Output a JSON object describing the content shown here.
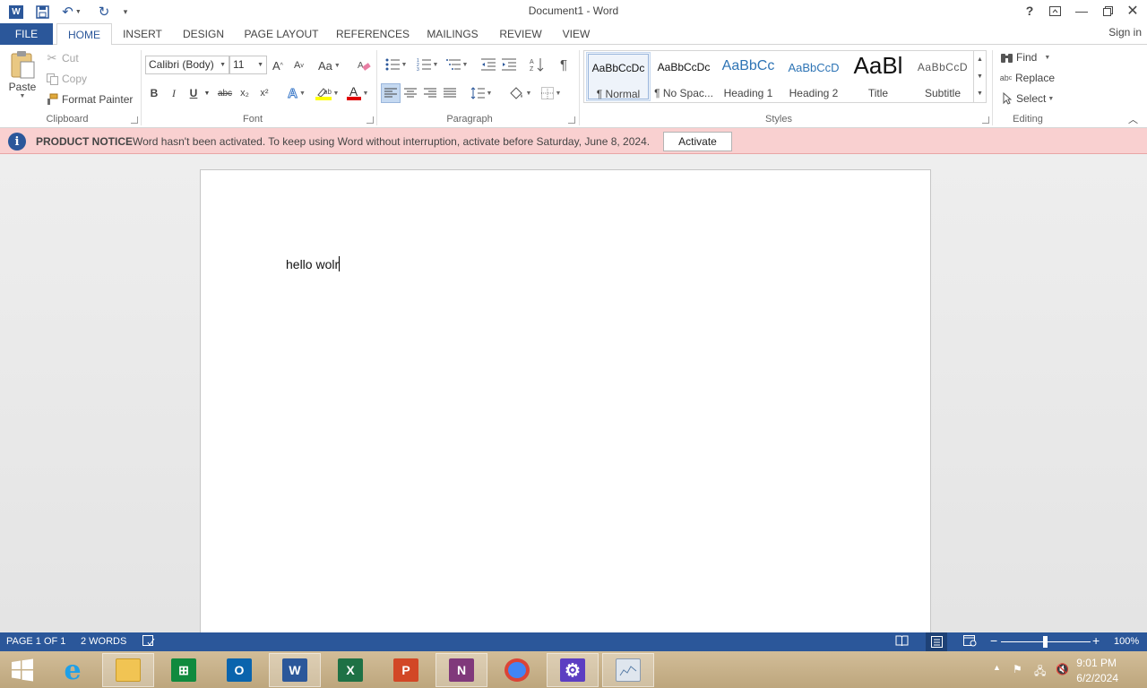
{
  "window": {
    "title": "Document1 - Word",
    "signin": "Sign in"
  },
  "tabs": [
    "FILE",
    "HOME",
    "INSERT",
    "DESIGN",
    "PAGE LAYOUT",
    "REFERENCES",
    "MAILINGS",
    "REVIEW",
    "VIEW"
  ],
  "clipboard": {
    "paste": "Paste",
    "cut": "Cut",
    "copy": "Copy",
    "format_painter": "Format Painter",
    "group": "Clipboard"
  },
  "font": {
    "name": "Calibri (Body)",
    "size": "11",
    "group": "Font",
    "bold": "B",
    "italic": "I",
    "underline": "U",
    "strike": "abc",
    "sub": "x₂",
    "sup": "x²",
    "case": "Aa",
    "grow": "A",
    "shrink": "A",
    "effects": "A",
    "color": "A",
    "highlight_color": "#ffff00",
    "font_color": "#e00000"
  },
  "paragraph": {
    "group": "Paragraph",
    "pilcrow": "¶"
  },
  "styles": {
    "group": "Styles",
    "items": [
      {
        "preview": "AaBbCcDc",
        "name": "¶ Normal"
      },
      {
        "preview": "AaBbCcDc",
        "name": "¶ No Spac..."
      },
      {
        "preview": "AaBbCc",
        "name": "Heading 1"
      },
      {
        "preview": "AaBbCcD",
        "name": "Heading 2"
      },
      {
        "preview": "AaBl",
        "name": "Title"
      },
      {
        "preview": "AaBbCcD",
        "name": "Subtitle"
      }
    ]
  },
  "editing": {
    "group": "Editing",
    "find": "Find",
    "replace": "Replace",
    "select": "Select"
  },
  "notice": {
    "title": "PRODUCT NOTICE",
    "message": "Word hasn't been activated. To keep using Word without interruption, activate before Saturday, June 8, 2024.",
    "button": "Activate"
  },
  "document": {
    "text": "hello wolr"
  },
  "status": {
    "page": "PAGE 1 OF 1",
    "words": "2 WORDS",
    "zoom": "100%"
  },
  "taskbar": {
    "time": "9:01 PM",
    "date": "6/2/2024"
  },
  "colors": {
    "word_blue": "#2b579a",
    "notice_bg": "#f9d0d0"
  }
}
